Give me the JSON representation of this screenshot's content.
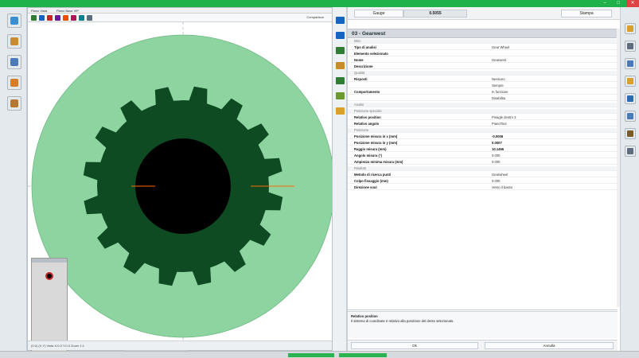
{
  "window": {
    "title": "",
    "minimize_glyph": "–",
    "maximize_glyph": "□",
    "close_glyph": "✕",
    "accent_color": "#1fb24a"
  },
  "viewer": {
    "tabs": [
      "Piano Vista",
      "Piano Base VIP"
    ],
    "tool_window_label": "Comparison",
    "status_text": "(0.0) (X,Y) Vista  X:0.0 Y:0.0 Zoom 1:1",
    "gear_colors": {
      "outer_ring": "#8dd4a0",
      "gear_body": "#0e4a22",
      "bore": "#000000",
      "thumb_marker": "#c62828"
    },
    "left_toolbar_icons": [
      {
        "name": "picture-icon",
        "color": "#3b8ed0"
      },
      {
        "name": "probe-icon",
        "color": "#c88c2a"
      },
      {
        "name": "image-frame-icon",
        "color": "#4a7ab8"
      },
      {
        "name": "tree-icon",
        "color": "#d97c27"
      },
      {
        "name": "layers-icon",
        "color": "#b57732"
      }
    ],
    "view_toolbar_icons": [
      {
        "name": "home-icon",
        "color": "#2e7d32"
      },
      {
        "name": "prev-icon",
        "color": "#1565c0"
      },
      {
        "name": "pan-icon",
        "color": "#c62828"
      },
      {
        "name": "zoom-icon",
        "color": "#6a1b9a"
      },
      {
        "name": "point-icon",
        "color": "#e65100"
      },
      {
        "name": "pen-icon",
        "color": "#ad1457"
      },
      {
        "name": "measure-icon",
        "color": "#00838f"
      },
      {
        "name": "table-icon",
        "color": "#5d6d7e"
      }
    ]
  },
  "mid_toolbar_icons": [
    {
      "name": "arrow-right-icon",
      "color": "#1565c0"
    },
    {
      "name": "arrow-left-icon",
      "color": "#1565c0"
    },
    {
      "name": "curve-icon",
      "color": "#2e7d32"
    },
    {
      "name": "target-icon",
      "color": "#c88c2a"
    },
    {
      "name": "refresh-icon",
      "color": "#2e7d32"
    },
    {
      "name": "bar-icon",
      "color": "#6a9a2e"
    },
    {
      "name": "folder-icon",
      "color": "#d9a12a"
    }
  ],
  "properties": {
    "top_label": "Gauge",
    "top_value": "0.5055",
    "top_right": "Stampa",
    "header": "03 - Gearwest",
    "rows": [
      {
        "kind": "group",
        "label": "Misc"
      },
      {
        "kind": "row",
        "label": "Tipo di analisi",
        "value": "Gear Wheel"
      },
      {
        "kind": "row",
        "label": "Elemento selezionato",
        "value": ""
      },
      {
        "kind": "row",
        "label": "Nome",
        "value": "Gearwest"
      },
      {
        "kind": "row",
        "label": "Descrizione",
        "value": ""
      },
      {
        "kind": "group",
        "label": "Qualità"
      },
      {
        "kind": "row",
        "label": "Risposti",
        "value": "Nessuno"
      },
      {
        "kind": "row",
        "label": "",
        "value": "Sempre"
      },
      {
        "kind": "row",
        "label": "Comportamento",
        "value": "In funzione"
      },
      {
        "kind": "row",
        "label": "",
        "value": "Disabilita"
      },
      {
        "kind": "group",
        "label": "Analisi"
      },
      {
        "kind": "group",
        "label": "Posizione speciale"
      },
      {
        "kind": "row",
        "label": "Relativo position",
        "value": "Pinagle dentro 3"
      },
      {
        "kind": "row",
        "label": "Relativo angolo",
        "value": "PianoTool"
      },
      {
        "kind": "group",
        "label": "Posizione"
      },
      {
        "kind": "row",
        "label": "Posizione misura in x (mm)",
        "value": "-0.0006",
        "bold": true
      },
      {
        "kind": "row",
        "label": "Posizione misura in y (mm)",
        "value": "0.0007",
        "bold": true
      },
      {
        "kind": "row",
        "label": "Raggio misura (mm)",
        "value": "10.1466",
        "bold": true
      },
      {
        "kind": "row",
        "label": "Angolo misura (°)",
        "value": "0.000"
      },
      {
        "kind": "row",
        "label": "Ampiezza minima misura (mm)",
        "value": "0.000"
      },
      {
        "kind": "group",
        "label": "Risultati"
      },
      {
        "kind": "row",
        "label": "Metodo di ricerca punti",
        "value": "Gearwheel"
      },
      {
        "kind": "row",
        "label": "Colpo fissaggio (mm)",
        "value": "0.000"
      },
      {
        "kind": "row",
        "label": "Direzione soul",
        "value": "Verso il basso"
      }
    ],
    "description_title": "Relativo position",
    "description_text": "Il sistema di coordinate è relativo alla posizione del dente selezionato.",
    "ok_label": "Ok",
    "cancel_label": "Annulla"
  },
  "right_toolbar_icons": [
    {
      "name": "shield-icon",
      "color": "#d9a12a"
    },
    {
      "name": "printer-icon",
      "color": "#5d6d7e"
    },
    {
      "name": "diagram-icon",
      "color": "#4a7ab8"
    },
    {
      "name": "folder-open-icon",
      "color": "#d9a12a"
    },
    {
      "name": "save-icon",
      "color": "#2b6cb0"
    },
    {
      "name": "scatter-icon",
      "color": "#4a7ab8"
    },
    {
      "name": "hand-icon",
      "color": "#7a5a2a"
    },
    {
      "name": "wrench-icon",
      "color": "#5d6d7e"
    }
  ],
  "taskbar_color": "#2bb34f"
}
